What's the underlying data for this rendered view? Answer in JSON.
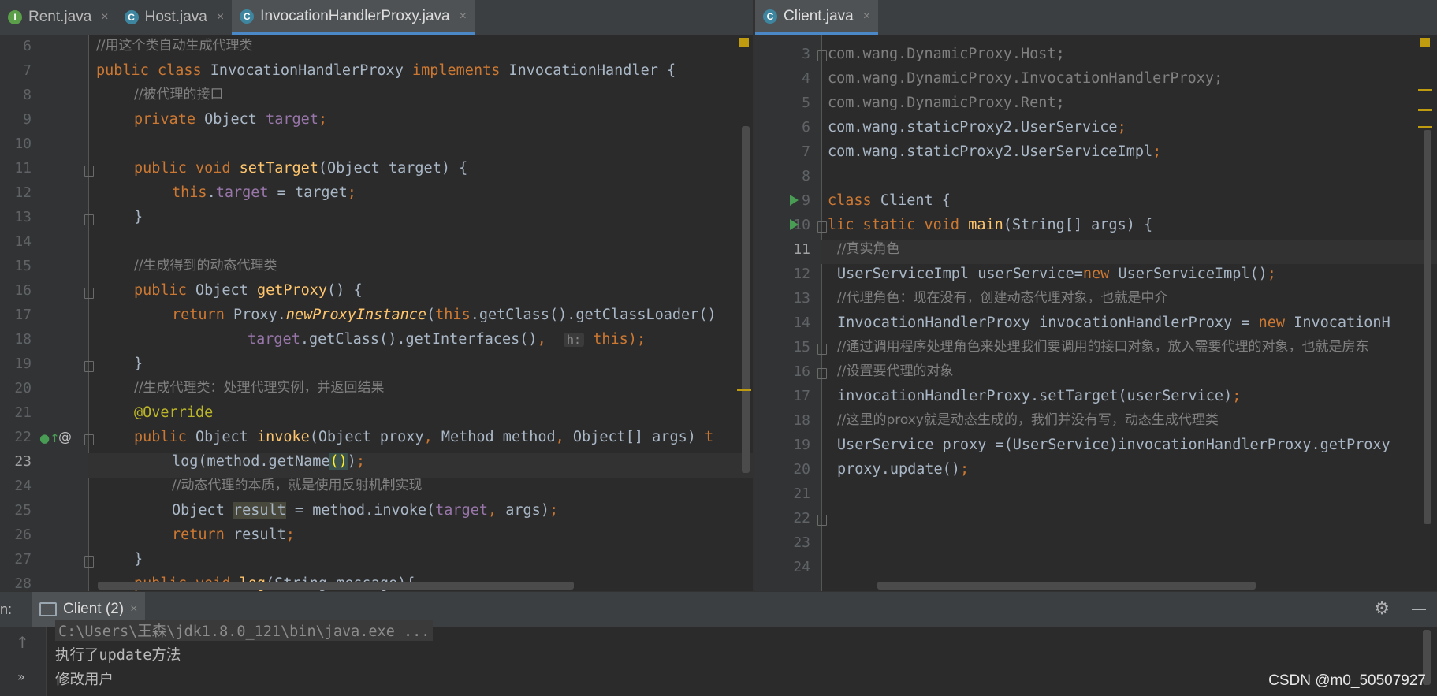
{
  "left_tabs": [
    {
      "label": "Rent.java",
      "icon": "I",
      "active": false
    },
    {
      "label": "Host.java",
      "icon": "C",
      "active": false
    },
    {
      "label": "InvocationHandlerProxy.java",
      "icon": "C",
      "active": true
    }
  ],
  "right_tabs": [
    {
      "label": "Client.java",
      "icon": "C",
      "active": true
    }
  ],
  "close_glyph": "×",
  "left_editor": {
    "line_numbers": [
      "6",
      "7",
      "8",
      "9",
      "10",
      "11",
      "12",
      "13",
      "14",
      "15",
      "16",
      "17",
      "18",
      "19",
      "20",
      "21",
      "22",
      "23",
      "24",
      "25",
      "26",
      "27",
      "28"
    ],
    "current_line": "23",
    "code": {
      "l6": "//用这个类自动生成代理类",
      "l7_kw": "public class ",
      "l7_cls": "InvocationHandlerProxy ",
      "l7_impl": "implements ",
      "l7_iface": "InvocationHandler {",
      "l8": "//被代理的接口",
      "l9_kw": "private ",
      "l9_type": "Object ",
      "l9_field": "target",
      "l9_end": ";",
      "l11_kw": "public void ",
      "l11_fn": "setTarget",
      "l11_rest": "(Object target) {",
      "l12_this": "this",
      "l12_dot": ".",
      "l12_field": "target",
      "l12_rest": " = target",
      "l12_semi": ";",
      "l13": "}",
      "l15": "//生成得到的动态代理类",
      "l16_kw": "public ",
      "l16_type": "Object ",
      "l16_fn": "getProxy",
      "l16_rest": "() {",
      "l17_kw": "return ",
      "l17_proxy": "Proxy.",
      "l17_ital": "newProxyInstance",
      "l17_paren": "(",
      "l17_this": "this",
      "l17_rest": ".getClass().getClassLoader()",
      "l18_field": "target",
      "l18_rest": ".getClass().getInterfaces()",
      "l18_comma": ", ",
      "l18_hint": "h:",
      "l18_this": "this",
      "l18_end": ");",
      "l19": "}",
      "l20": "//生成代理类：处理代理实例，并返回结果",
      "l21": "@Override",
      "l22_kw": "public ",
      "l22_type": "Object ",
      "l22_fn": "invoke",
      "l22_a": "(Object proxy",
      "l22_c1": ", ",
      "l22_b": "Method method",
      "l22_c2": ", ",
      "l22_c": "Object[] args) ",
      "l22_t": "t",
      "l23_a": "log(method.getName",
      "l23_brace": "()",
      "l23_b": ")",
      "l23_semi": ";",
      "l24": "//动态代理的本质，就是使用反射机制实现",
      "l25_a": "Object ",
      "l25_res": "result",
      "l25_b": " = method.invoke(",
      "l25_field": "target",
      "l25_c": ", ",
      "l25_d": "args)",
      "l25_semi": ";",
      "l26_kw": "return ",
      "l26_rest": "result",
      "l26_semi": ";",
      "l27": "}",
      "l28_kw": "public void ",
      "l28_fn": "log",
      "l28_rest": "(String message){"
    }
  },
  "right_editor": {
    "line_numbers": [
      "3",
      "4",
      "5",
      "6",
      "7",
      "8",
      "9",
      "10",
      "11",
      "12",
      "13",
      "14",
      "15",
      "16",
      "17",
      "18",
      "19",
      "20",
      "21",
      "22",
      "23",
      "24"
    ],
    "current_line": "11",
    "code": {
      "r3": "com.wang.DynamicProxy.Host;",
      "r4": "com.wang.DynamicProxy.InvocationHandlerProxy;",
      "r5": "com.wang.DynamicProxy.Rent;",
      "r6_a": "com.wang.staticProxy2.UserService",
      "r6_semi": ";",
      "r7_a": "com.wang.staticProxy2.UserServiceImpl",
      "r7_semi": ";",
      "r9_kw": "class ",
      "r9_rest": "Client {",
      "r10_kw": "lic static void ",
      "r10_fn": "main",
      "r10_rest": "(String[] args) {",
      "r11": "//真实角色",
      "r12_a": "UserServiceImpl userService=",
      "r12_new": "new ",
      "r12_b": "UserServiceImpl()",
      "r12_semi": ";",
      "r13": "//代理角色：现在没有，创建动态代理对象，也就是中介",
      "r14_a": "InvocationHandlerProxy invocationHandlerProxy = ",
      "r14_new": "new ",
      "r14_b": "InvocationH",
      "r15": "//通过调用程序处理角色来处理我们要调用的接口对象，放入需要代理的对象，也就是房东",
      "r16": "//设置要代理的对象",
      "r17_a": "invocationHandlerProxy.setTarget(userService)",
      "r17_semi": ";",
      "r18": "//这里的proxy就是动态生成的，我们并没有写，动态生成代理类",
      "r19": "UserService proxy =(UserService)invocationHandlerProxy.getProxy",
      "r20_a": "proxy.update()",
      "r20_semi": ";"
    }
  },
  "run_panel": {
    "label": "n:",
    "tab_label": "Client (2)",
    "console_lines": [
      "C:\\Users\\王森\\jdk1.8.0_121\\bin\\java.exe ...",
      "执行了update方法",
      "修改用户"
    ]
  },
  "watermark": "CSDN @m0_50507927",
  "colors": {
    "keyword": "#cc7832",
    "comment": "#808080",
    "function": "#ffc66d",
    "field": "#9876aa",
    "annotation": "#bbb529",
    "accent": "#4a88c7"
  }
}
